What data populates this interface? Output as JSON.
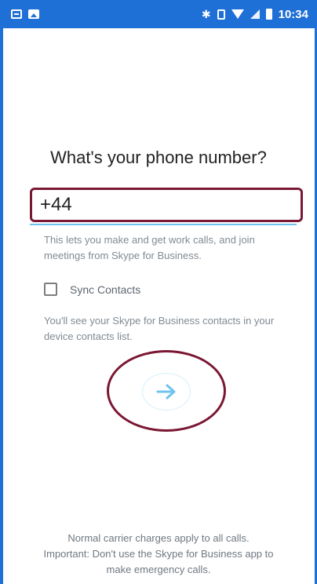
{
  "status_bar": {
    "time": "10:34",
    "icons": [
      "notification-icon",
      "image-icon",
      "bluetooth-icon",
      "vibrate-icon",
      "wifi-icon",
      "signal-icon",
      "battery-icon"
    ],
    "color": "#1e6fd6"
  },
  "setup": {
    "title": "What's your phone number?",
    "phone_value": "+44",
    "help_text": "This lets you make and get work calls, and join meetings from Skype for Business.",
    "sync_contacts_label": "Sync Contacts",
    "sync_contacts_checked": false,
    "sync_help": "You'll see your Skype for Business contacts in your device contacts list.",
    "next_icon": "arrow-right-icon"
  },
  "footer": {
    "line1": "Normal carrier charges apply to all calls.",
    "line2": "Important: Don't use the Skype for Business app to",
    "line3": "make emergency calls."
  },
  "colors": {
    "accent": "#6fc3ee",
    "highlight": "#7a1733",
    "muted_text": "#808a93"
  }
}
